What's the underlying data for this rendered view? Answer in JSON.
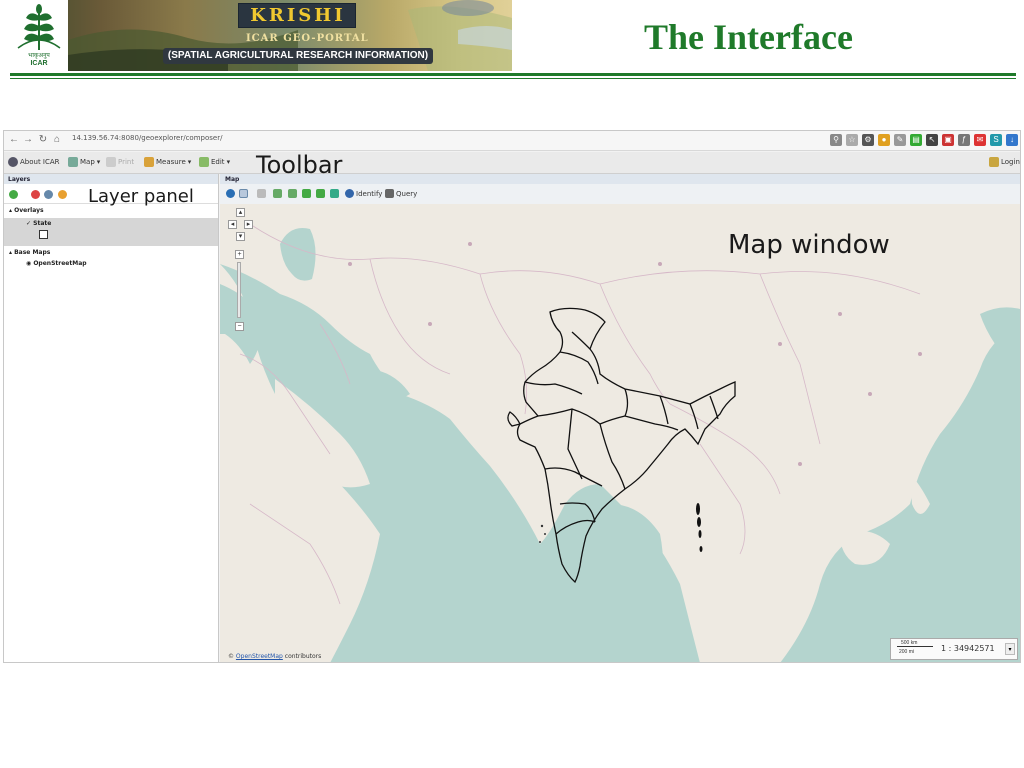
{
  "header": {
    "banner_title": "KRISHI",
    "banner_subtitle": "ICAR GEO-PORTAL",
    "banner_tagline": "(SPATIAL AGRICULTURAL RESEARCH INFORMATION)",
    "logo_hindi": "भाकृअनुप",
    "logo_text": "ICAR",
    "slide_title": "The Interface",
    "accent_color": "#1f7a2a"
  },
  "browser": {
    "url": "14.139.56.74:8080/geoexplorer/composer/",
    "nav_icons": [
      "back-icon",
      "forward-icon",
      "reload-icon",
      "home-icon"
    ]
  },
  "toolbar": {
    "about": "About ICAR",
    "map": "Map",
    "print": "Print",
    "measure": "Measure",
    "edit": "Edit",
    "login": "Login",
    "callout": "Toolbar"
  },
  "layers_panel": {
    "header": "Layers",
    "callout": "Layer panel",
    "overlays": "Overlays",
    "state": "State",
    "base_maps": "Base Maps",
    "openstreetmap": "OpenStreetMap"
  },
  "map_panel": {
    "header": "Map",
    "identify": "Identify",
    "query": "Query",
    "callout": "Map window",
    "attribution_prefix": "©",
    "attribution_link": "OpenStreetMap",
    "attribution_suffix": "contributors",
    "scale_top": "500 km",
    "scale_bottom": "200 mi",
    "scale_ratio": "1 : 34942571",
    "water_color": "#b4d4ce",
    "land_color": "#eeeae2"
  }
}
